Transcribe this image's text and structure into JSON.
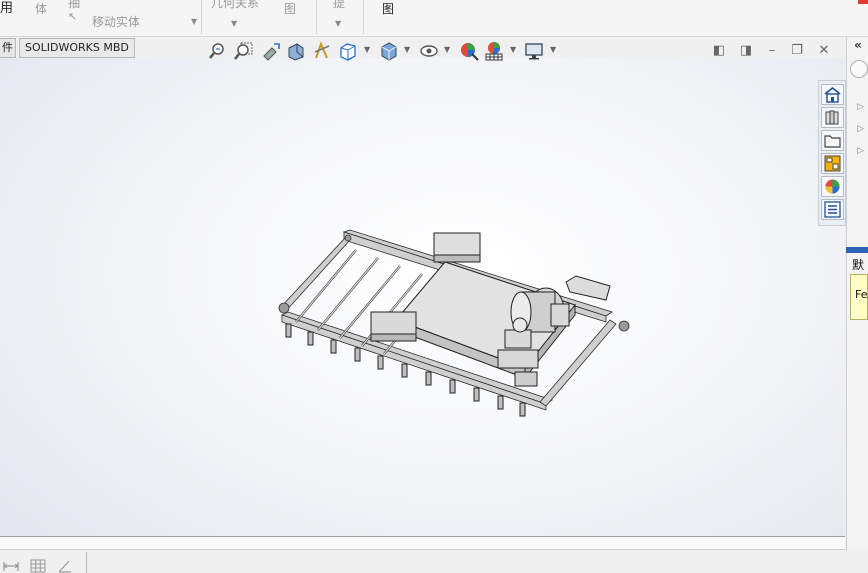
{
  "ribbon": {
    "items": [
      {
        "id": "yong",
        "label": "用"
      },
      {
        "id": "ti",
        "label": "体"
      },
      {
        "id": "chou",
        "label": "抽"
      },
      {
        "id": "move_body",
        "label": "移动实体"
      },
      {
        "id": "relations",
        "label": "几何关系"
      },
      {
        "id": "tu",
        "label": "图"
      },
      {
        "id": "ti2",
        "label": "提"
      },
      {
        "id": "tu2",
        "label": "图"
      }
    ]
  },
  "tabs": [
    {
      "id": "parts",
      "label": "件"
    },
    {
      "id": "mbd",
      "label": "SOLIDWORKS MBD"
    }
  ],
  "hud_toolbar": {
    "buttons": [
      {
        "id": "zoom-to-fit",
        "icon": "zoom-to-fit-icon"
      },
      {
        "id": "zoom-area",
        "icon": "zoom-area-icon"
      },
      {
        "id": "previous-view",
        "icon": "previous-view-icon"
      },
      {
        "id": "section-view",
        "icon": "section-view-icon"
      },
      {
        "id": "dynamic-annotation",
        "icon": "dynamic-annotation-icon"
      },
      {
        "id": "view-orientation",
        "icon": "view-orientation-icon"
      },
      {
        "id": "display-style",
        "icon": "display-style-icon"
      },
      {
        "id": "hide-show",
        "icon": "hide-show-icon"
      },
      {
        "id": "edit-appearance",
        "icon": "edit-appearance-icon"
      },
      {
        "id": "apply-scene",
        "icon": "apply-scene-icon"
      },
      {
        "id": "view-settings",
        "icon": "view-settings-icon"
      }
    ]
  },
  "task_pane": {
    "buttons": [
      {
        "id": "home",
        "icon": "home-icon"
      },
      {
        "id": "design-library",
        "icon": "design-library-icon"
      },
      {
        "id": "file-explorer",
        "icon": "folder-icon"
      },
      {
        "id": "view-palette",
        "icon": "view-palette-icon"
      },
      {
        "id": "appearances",
        "icon": "appearances-icon"
      },
      {
        "id": "custom-properties",
        "icon": "custom-properties-icon"
      }
    ],
    "label": "默认",
    "note": "Fe"
  },
  "colors": {
    "accent_blue": "#2d63b7",
    "note_yellow": "#ffffc4"
  }
}
